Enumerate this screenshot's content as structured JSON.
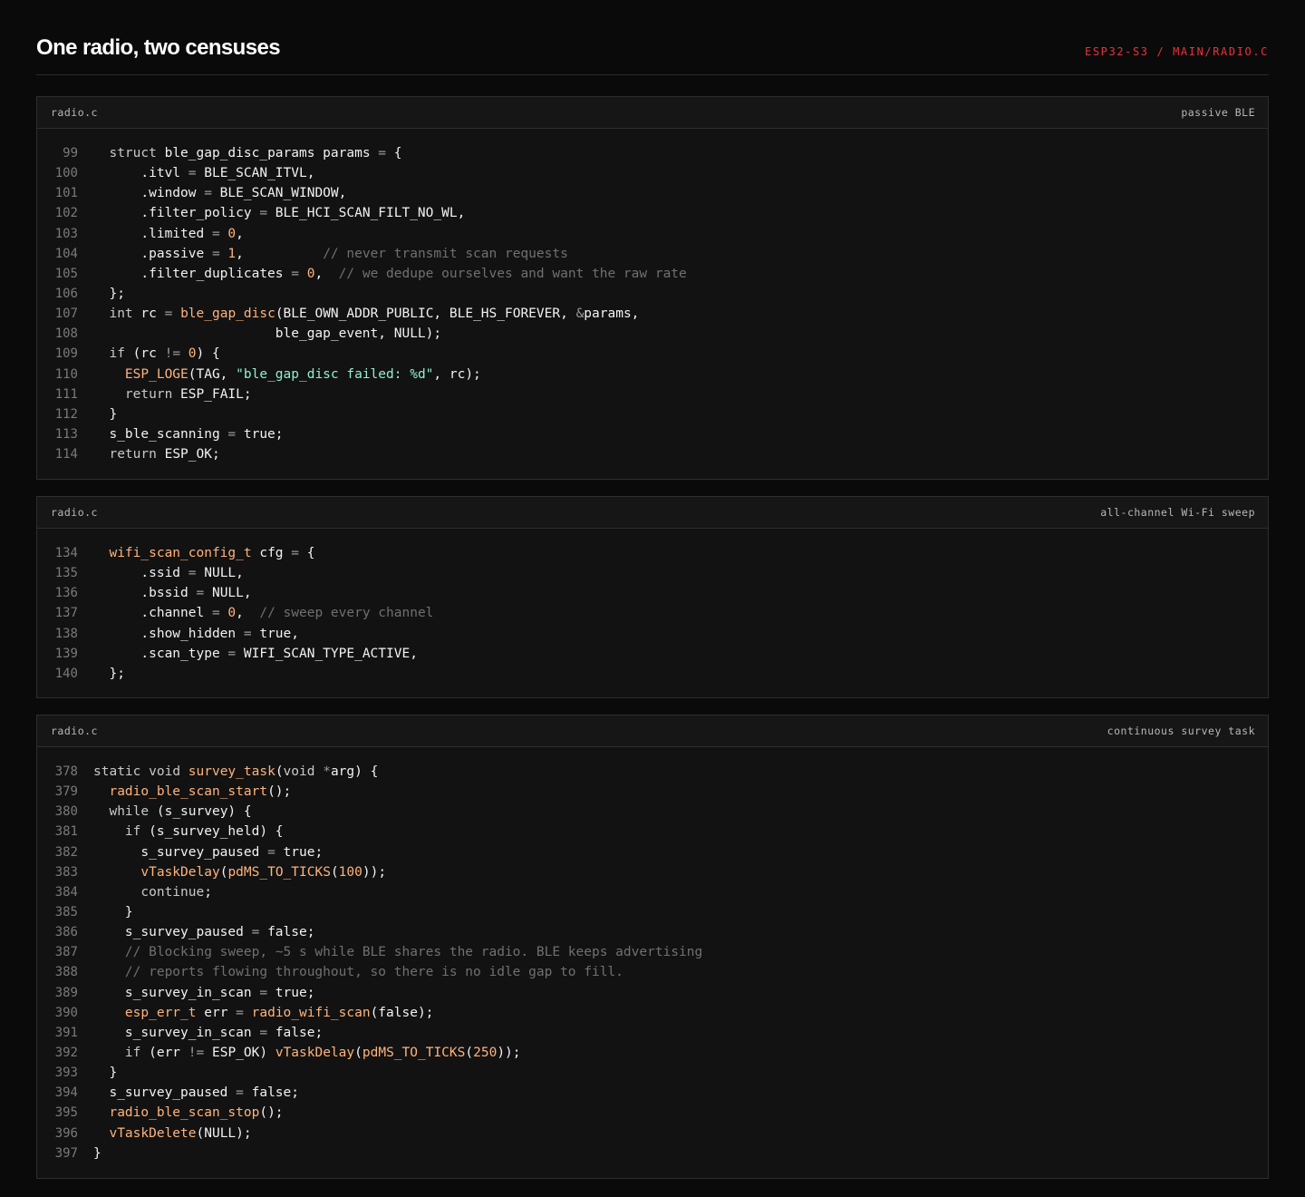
{
  "header": {
    "title": "One radio, two censuses",
    "crumb": "ESP32-S3 / MAIN/RADIO.C"
  },
  "panels": [
    {
      "file": "radio.c",
      "tag": "passive BLE",
      "lines": [
        {
          "n": "99",
          "code": "  struct ble_gap_disc_params params = {"
        },
        {
          "n": "100",
          "code": "      .itvl = BLE_SCAN_ITVL,"
        },
        {
          "n": "101",
          "code": "      .window = BLE_SCAN_WINDOW,"
        },
        {
          "n": "102",
          "code": "      .filter_policy = BLE_HCI_SCAN_FILT_NO_WL,"
        },
        {
          "n": "103",
          "code": "      .limited = 0,"
        },
        {
          "n": "104",
          "code": "      .passive = 1,          // never transmit scan requests"
        },
        {
          "n": "105",
          "code": "      .filter_duplicates = 0,  // we dedupe ourselves and want the raw rate"
        },
        {
          "n": "106",
          "code": "  };"
        },
        {
          "n": "107",
          "code": "  int rc = ble_gap_disc(BLE_OWN_ADDR_PUBLIC, BLE_HS_FOREVER, &params,"
        },
        {
          "n": "108",
          "code": "                       ble_gap_event, NULL);"
        },
        {
          "n": "109",
          "code": "  if (rc != 0) {"
        },
        {
          "n": "110",
          "code": "    ESP_LOGE(TAG, \"ble_gap_disc failed: %d\", rc);"
        },
        {
          "n": "111",
          "code": "    return ESP_FAIL;"
        },
        {
          "n": "112",
          "code": "  }"
        },
        {
          "n": "113",
          "code": "  s_ble_scanning = true;"
        },
        {
          "n": "114",
          "code": "  return ESP_OK;"
        }
      ]
    },
    {
      "file": "radio.c",
      "tag": "all-channel Wi-Fi sweep",
      "lines": [
        {
          "n": "134",
          "code": "  wifi_scan_config_t cfg = {"
        },
        {
          "n": "135",
          "code": "      .ssid = NULL,"
        },
        {
          "n": "136",
          "code": "      .bssid = NULL,"
        },
        {
          "n": "137",
          "code": "      .channel = 0,  // sweep every channel"
        },
        {
          "n": "138",
          "code": "      .show_hidden = true,"
        },
        {
          "n": "139",
          "code": "      .scan_type = WIFI_SCAN_TYPE_ACTIVE,"
        },
        {
          "n": "140",
          "code": "  };"
        }
      ]
    },
    {
      "file": "radio.c",
      "tag": "continuous survey task",
      "lines": [
        {
          "n": "378",
          "code": "static void survey_task(void *arg) {"
        },
        {
          "n": "379",
          "code": "  radio_ble_scan_start();"
        },
        {
          "n": "380",
          "code": "  while (s_survey) {"
        },
        {
          "n": "381",
          "code": "    if (s_survey_held) {"
        },
        {
          "n": "382",
          "code": "      s_survey_paused = true;"
        },
        {
          "n": "383",
          "code": "      vTaskDelay(pdMS_TO_TICKS(100));"
        },
        {
          "n": "384",
          "code": "      continue;"
        },
        {
          "n": "385",
          "code": "    }"
        },
        {
          "n": "386",
          "code": "    s_survey_paused = false;"
        },
        {
          "n": "387",
          "code": "    // Blocking sweep, ~5 s while BLE shares the radio. BLE keeps advertising"
        },
        {
          "n": "388",
          "code": "    // reports flowing throughout, so there is no idle gap to fill."
        },
        {
          "n": "389",
          "code": "    s_survey_in_scan = true;"
        },
        {
          "n": "390",
          "code": "    esp_err_t err = radio_wifi_scan(false);"
        },
        {
          "n": "391",
          "code": "    s_survey_in_scan = false;"
        },
        {
          "n": "392",
          "code": "    if (err != ESP_OK) vTaskDelay(pdMS_TO_TICKS(250));"
        },
        {
          "n": "393",
          "code": "  }"
        },
        {
          "n": "394",
          "code": "  s_survey_paused = false;"
        },
        {
          "n": "395",
          "code": "  radio_ble_scan_stop();"
        },
        {
          "n": "396",
          "code": "  vTaskDelete(NULL);"
        },
        {
          "n": "397",
          "code": "}"
        }
      ]
    }
  ]
}
